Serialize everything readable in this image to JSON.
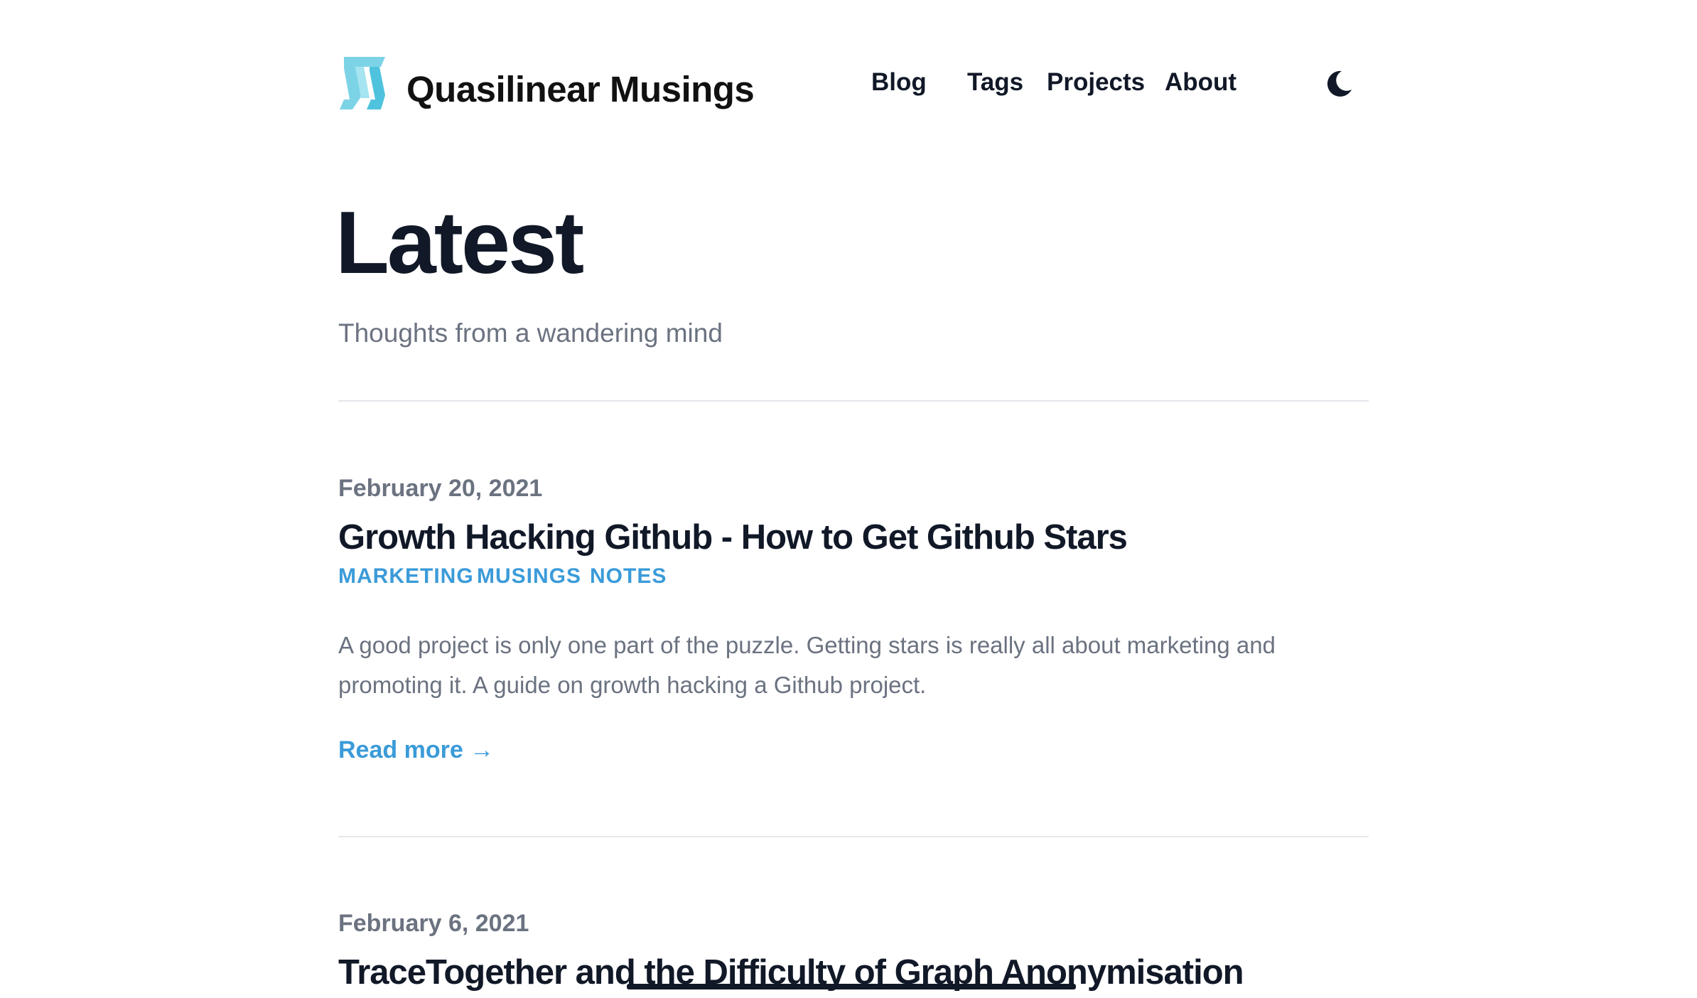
{
  "header": {
    "site_title": "Quasilinear Musings",
    "nav": [
      "Blog",
      "Tags",
      "Projects",
      "About"
    ],
    "theme_toggle_icon": "moon-icon",
    "logo_colors": [
      "#7dd3e6",
      "#4fc3dd"
    ]
  },
  "hero": {
    "title": "Latest",
    "subtitle": "Thoughts from a wandering mind"
  },
  "posts": [
    {
      "date": "February 20, 2021",
      "title": "Growth Hacking Github - How to Get Github Stars",
      "tags": [
        "MARKETING",
        "MUSINGS",
        "NOTES"
      ],
      "summary": "A good project is only one part of the puzzle. Getting stars is really all about marketing and promoting it. A guide on growth hacking a Github project.",
      "read_more": "Read more →"
    },
    {
      "date": "February 6, 2021",
      "title": "TraceTogether and the Difficulty of Graph Anonymisation"
    }
  ],
  "colors": {
    "accent": "#3b9bd9",
    "text": "#111827",
    "muted": "#6b7280",
    "divider": "#e5e7eb"
  }
}
